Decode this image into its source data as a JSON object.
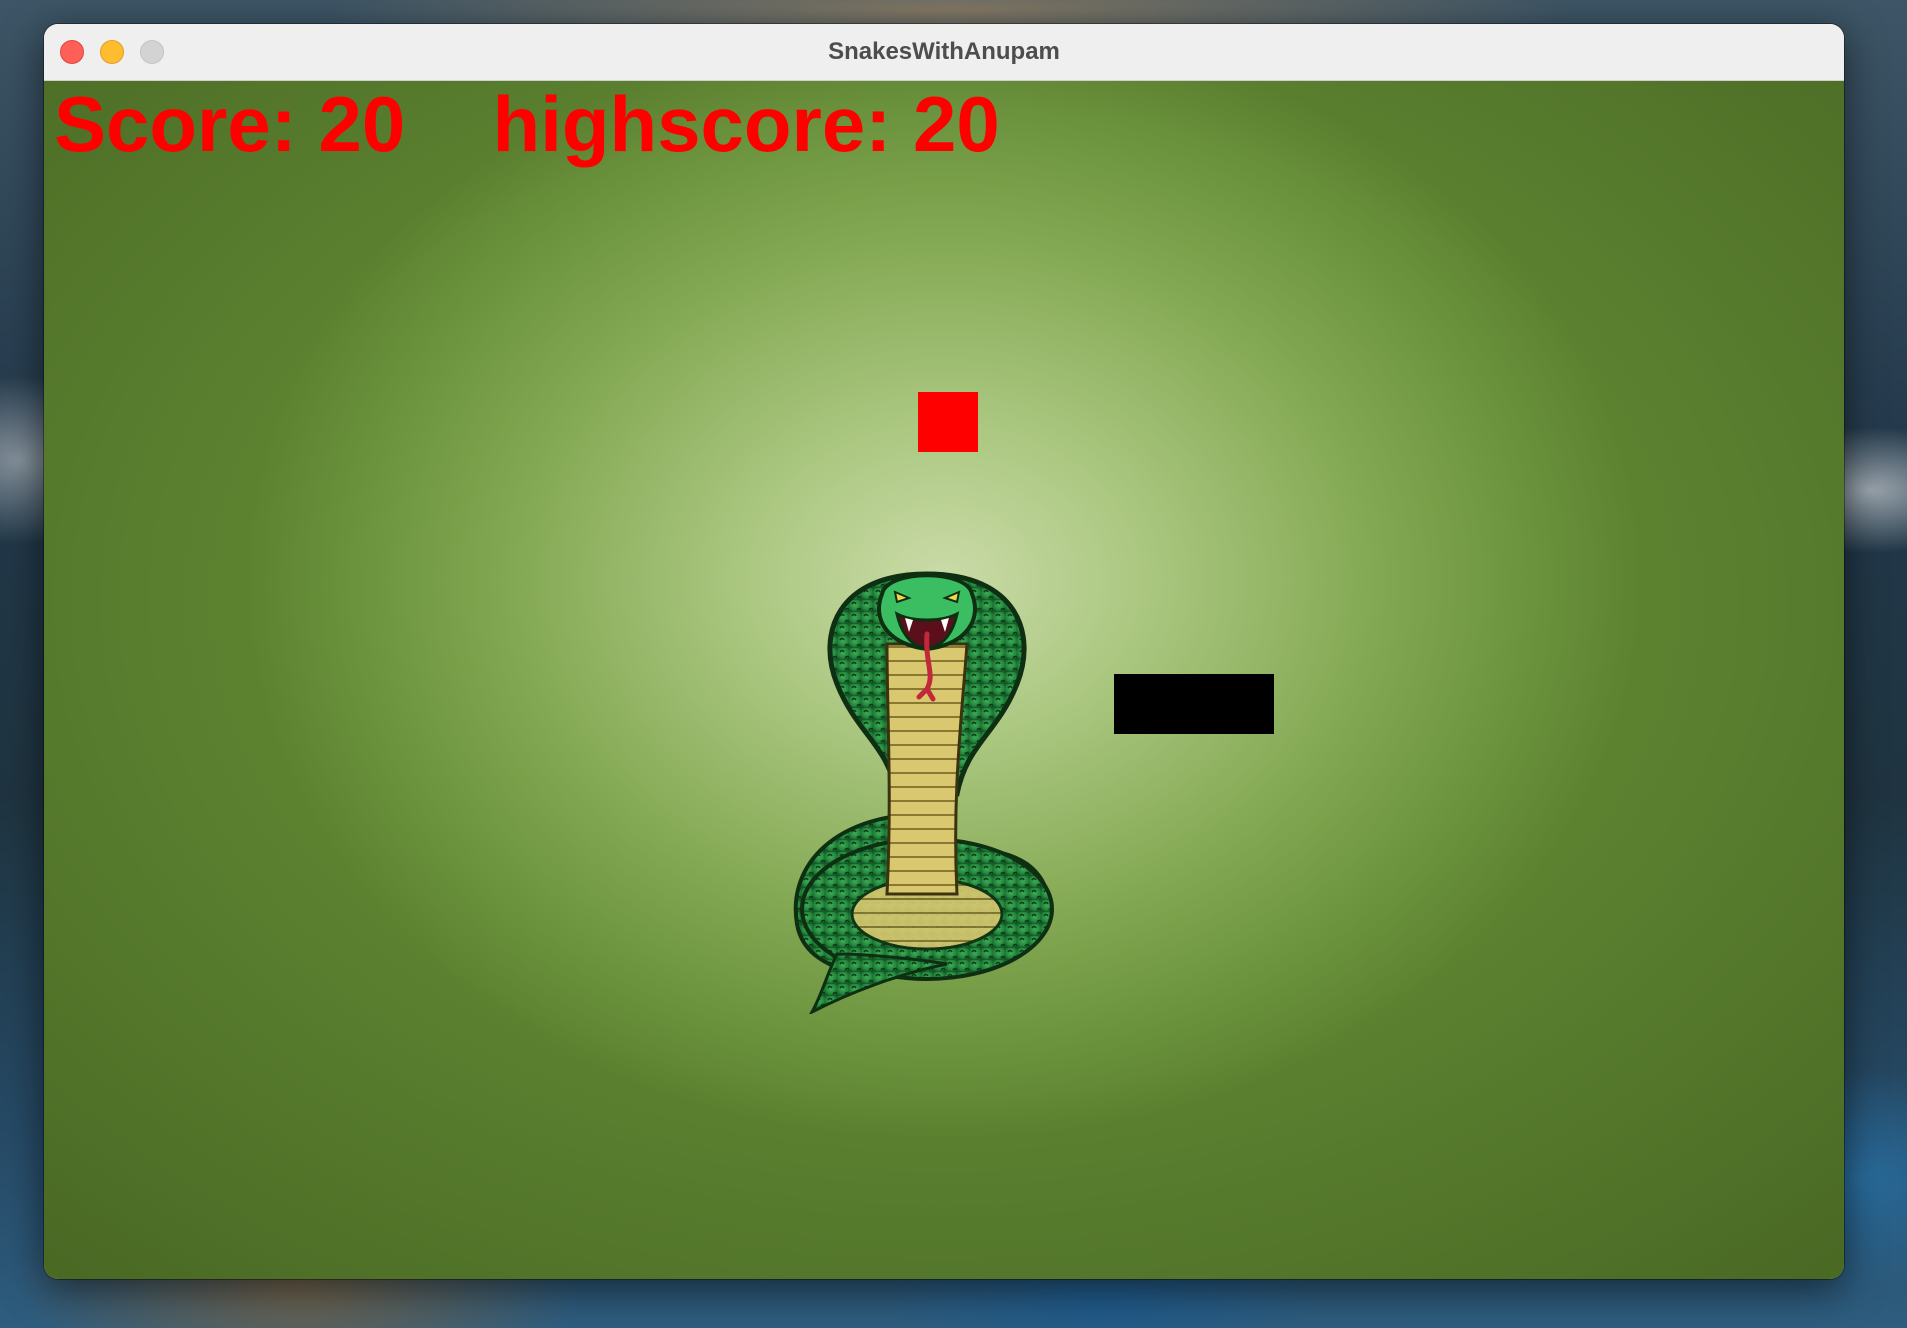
{
  "window": {
    "title": "SnakesWithAnupam"
  },
  "hud": {
    "score_label": "Score:",
    "score_value": "20",
    "highscore_label": "highscore:",
    "highscore_value": "20"
  },
  "colors": {
    "hud_text": "#ff0000",
    "food": "#ff0000",
    "snake": "#000000",
    "background_center": "#cadba8",
    "background_edge": "#5c8230"
  },
  "icons": {
    "close": "close-button",
    "minimize": "minimize-button",
    "maximize": "maximize-button",
    "background_art": "cobra-icon"
  }
}
